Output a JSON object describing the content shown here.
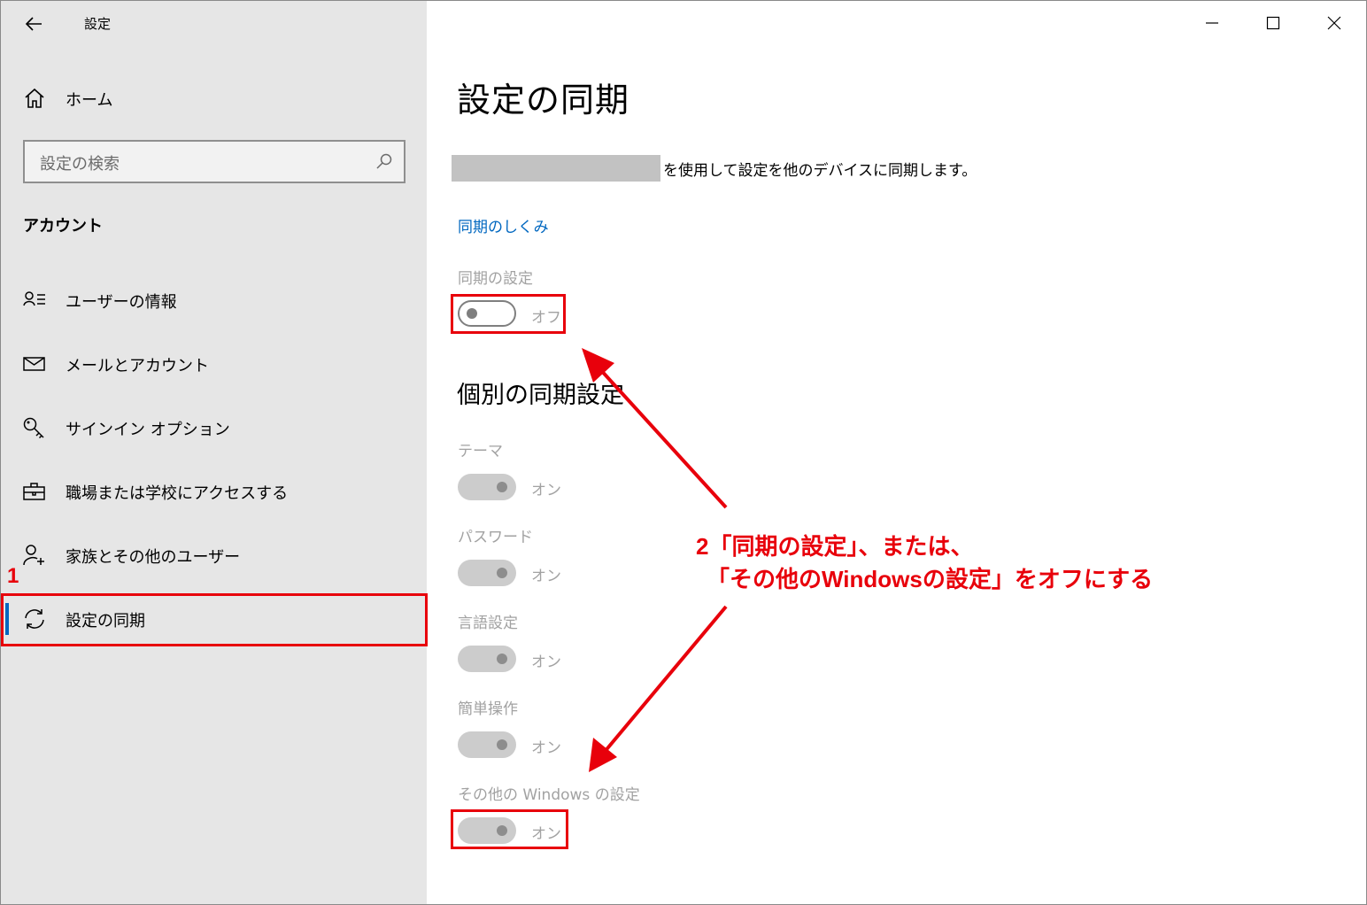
{
  "window": {
    "app_title": "設定",
    "minimize_glyph": "—",
    "maximize_glyph": "☐",
    "close_glyph": "✕"
  },
  "sidebar": {
    "home_label": "ホーム",
    "search_placeholder": "設定の検索",
    "section_heading": "アカウント",
    "items": [
      {
        "label": "ユーザーの情報",
        "icon": "user-info-icon"
      },
      {
        "label": "メールとアカウント",
        "icon": "mail-icon"
      },
      {
        "label": "サインイン オプション",
        "icon": "key-icon"
      },
      {
        "label": "職場または学校にアクセスする",
        "icon": "briefcase-icon"
      },
      {
        "label": "家族とその他のユーザー",
        "icon": "add-person-icon"
      },
      {
        "label": "設定の同期",
        "icon": "sync-icon",
        "selected": true
      }
    ]
  },
  "main": {
    "page_title": "設定の同期",
    "description": "を使用して設定を他のデバイスに同期します。",
    "how_sync_link": "同期のしくみ",
    "sync_settings_label": "同期の設定",
    "sync_settings_state": "オフ",
    "individual_heading": "個別の同期設定",
    "individual_settings": [
      {
        "label": "テーマ",
        "state": "オン"
      },
      {
        "label": "パスワード",
        "state": "オン"
      },
      {
        "label": "言語設定",
        "state": "オン"
      },
      {
        "label": "簡単操作",
        "state": "オン"
      },
      {
        "label": "その他の Windows の設定",
        "state": "オン"
      }
    ]
  },
  "annotations": {
    "step1_number": "1",
    "step2_line1": "2「同期の設定」、または、",
    "step2_line2": "「その他のWindowsの設定」をオフにする",
    "color": "#e8000b"
  },
  "colors": {
    "sidebar_bg": "#e6e6e6",
    "accent": "#0067c0",
    "disabled_text": "#a2a2a2",
    "annotation_red": "#e8000b"
  }
}
